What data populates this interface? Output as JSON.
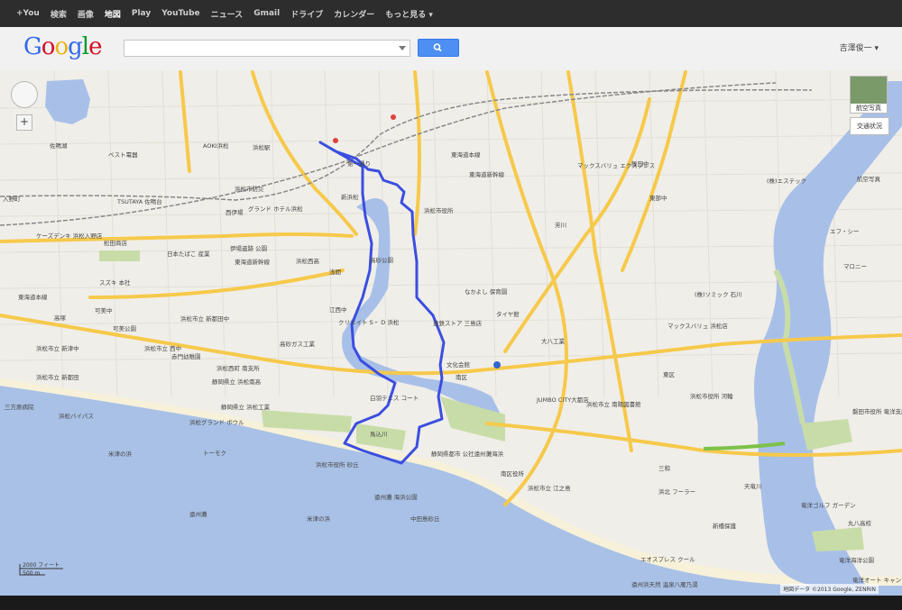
{
  "topnav": {
    "items": [
      "+You",
      "検索",
      "画像",
      "地図",
      "Play",
      "YouTube",
      "ニュース",
      "Gmail",
      "ドライブ",
      "カレンダー",
      "もっと見る ▾"
    ],
    "active_index": 3
  },
  "header": {
    "logo": [
      "G",
      "o",
      "o",
      "g",
      "l",
      "e"
    ],
    "search_placeholder": "",
    "search_icon": "search-icon",
    "user_name": "吉澤俊一 ▾"
  },
  "map": {
    "controls": {
      "aerial_label": "航空写真",
      "traffic_label": "交通状況",
      "zoom_in": "+"
    },
    "scale": {
      "feet": "2000 フィート",
      "meters": "500 m"
    },
    "copyright": "地図データ ©2013 Google, ZENRIN",
    "labels": [
      {
        "t": "佐鳴湖"
      },
      {
        "t": "ベスト電器"
      },
      {
        "t": "AOKI浜松"
      },
      {
        "t": "浜松駅"
      },
      {
        "t": "東海道本線"
      },
      {
        "t": "新浜松"
      },
      {
        "t": "第一通り"
      },
      {
        "t": "浜松市役所"
      },
      {
        "t": "東海道新幹線"
      },
      {
        "t": "マックスバリュ エクスプレス"
      },
      {
        "t": "飯田中"
      },
      {
        "t": "航空写真"
      },
      {
        "t": "浜松市防災"
      },
      {
        "t": "グランド ホテル浜松"
      },
      {
        "t": "西伊場"
      },
      {
        "t": "TSUTAYA 佐鳴台"
      },
      {
        "t": "入野町"
      },
      {
        "t": "ケーズデンキ 浜松入野店"
      },
      {
        "t": "松田商店"
      },
      {
        "t": "日本たばこ 産業"
      },
      {
        "t": "伊場遺跡 公園"
      },
      {
        "t": "東海道新幹線"
      },
      {
        "t": "浜松西高"
      },
      {
        "t": "浅間"
      },
      {
        "t": "高砂公園"
      },
      {
        "t": "東海道本線"
      },
      {
        "t": "スズキ 本社"
      },
      {
        "t": "高塚"
      },
      {
        "t": "可美中"
      },
      {
        "t": "可美公園"
      },
      {
        "t": "江西中"
      },
      {
        "t": "クリエイト S・ D 浜松"
      },
      {
        "t": "遠鉄ストア 三島店"
      },
      {
        "t": "なかよし 保育園"
      },
      {
        "t": "タイヤ館"
      },
      {
        "t": "浜松市立 新津中"
      },
      {
        "t": "高砂ガス工業"
      },
      {
        "t": "赤門幼稚園"
      },
      {
        "t": "浜松市立 新都田"
      },
      {
        "t": "白羽テニス コート"
      },
      {
        "t": "南区"
      },
      {
        "t": "文化会館"
      },
      {
        "t": "JUMBO CITY大都店"
      },
      {
        "t": "浜松市立 南陽図書館"
      },
      {
        "t": "浜松市役所 河輪"
      },
      {
        "t": "大八工業"
      },
      {
        "t": "マックスバリュ 浜松店"
      },
      {
        "t": "浜松西町 南支所"
      },
      {
        "t": "浜松バイパス"
      },
      {
        "t": "三方原病院"
      },
      {
        "t": "浜松グランド ボウル"
      },
      {
        "t": "トーモク"
      },
      {
        "t": "浜松市役所 砂丘"
      },
      {
        "t": "馬込川"
      },
      {
        "t": "遠州灘 海浜公園"
      },
      {
        "t": "米津の浜"
      },
      {
        "t": "遠州灘"
      },
      {
        "t": "中田島砂丘"
      },
      {
        "t": "静岡県都市 公社遠州灘海浜"
      },
      {
        "t": "南区役所"
      },
      {
        "t": "天竜川"
      },
      {
        "t": "浜松市立 江之島"
      },
      {
        "t": "浜北 フーラー"
      },
      {
        "t": "エオスプレス クール"
      },
      {
        "t": "遠州浜天然 温泉八雁乃湯"
      },
      {
        "t": "竜洋ゴルフ ガーデン"
      },
      {
        "t": "丸八高校"
      },
      {
        "t": "竜洋海洋公園"
      },
      {
        "t": "竜洋オート キャンプ場"
      },
      {
        "t": "遠州灘"
      },
      {
        "t": "磐田市役所 竜洋支所"
      },
      {
        "t": "マロニー"
      },
      {
        "t": "エフ・シー"
      },
      {
        "t": "(株)ソミック 石川"
      },
      {
        "t": "(株)エステック"
      },
      {
        "t": "東区"
      },
      {
        "t": "東部中"
      },
      {
        "t": "芳川"
      },
      {
        "t": "三和"
      },
      {
        "t": "新橋保護"
      },
      {
        "t": "静岡県立 浜松南高"
      },
      {
        "t": "静岡県立 浜松工業"
      },
      {
        "t": "浜松市立 西中"
      },
      {
        "t": "浜松市立 新都田中"
      },
      {
        "t": "米津の浜"
      }
    ]
  },
  "colors": {
    "water": "#a8c0e8",
    "land": "#f0eee8",
    "road_major": "#f6c94b",
    "road_minor": "#ffffff",
    "park": "#c8dca8",
    "route": "#3b4ee0",
    "sea": "#a9c1e6"
  }
}
